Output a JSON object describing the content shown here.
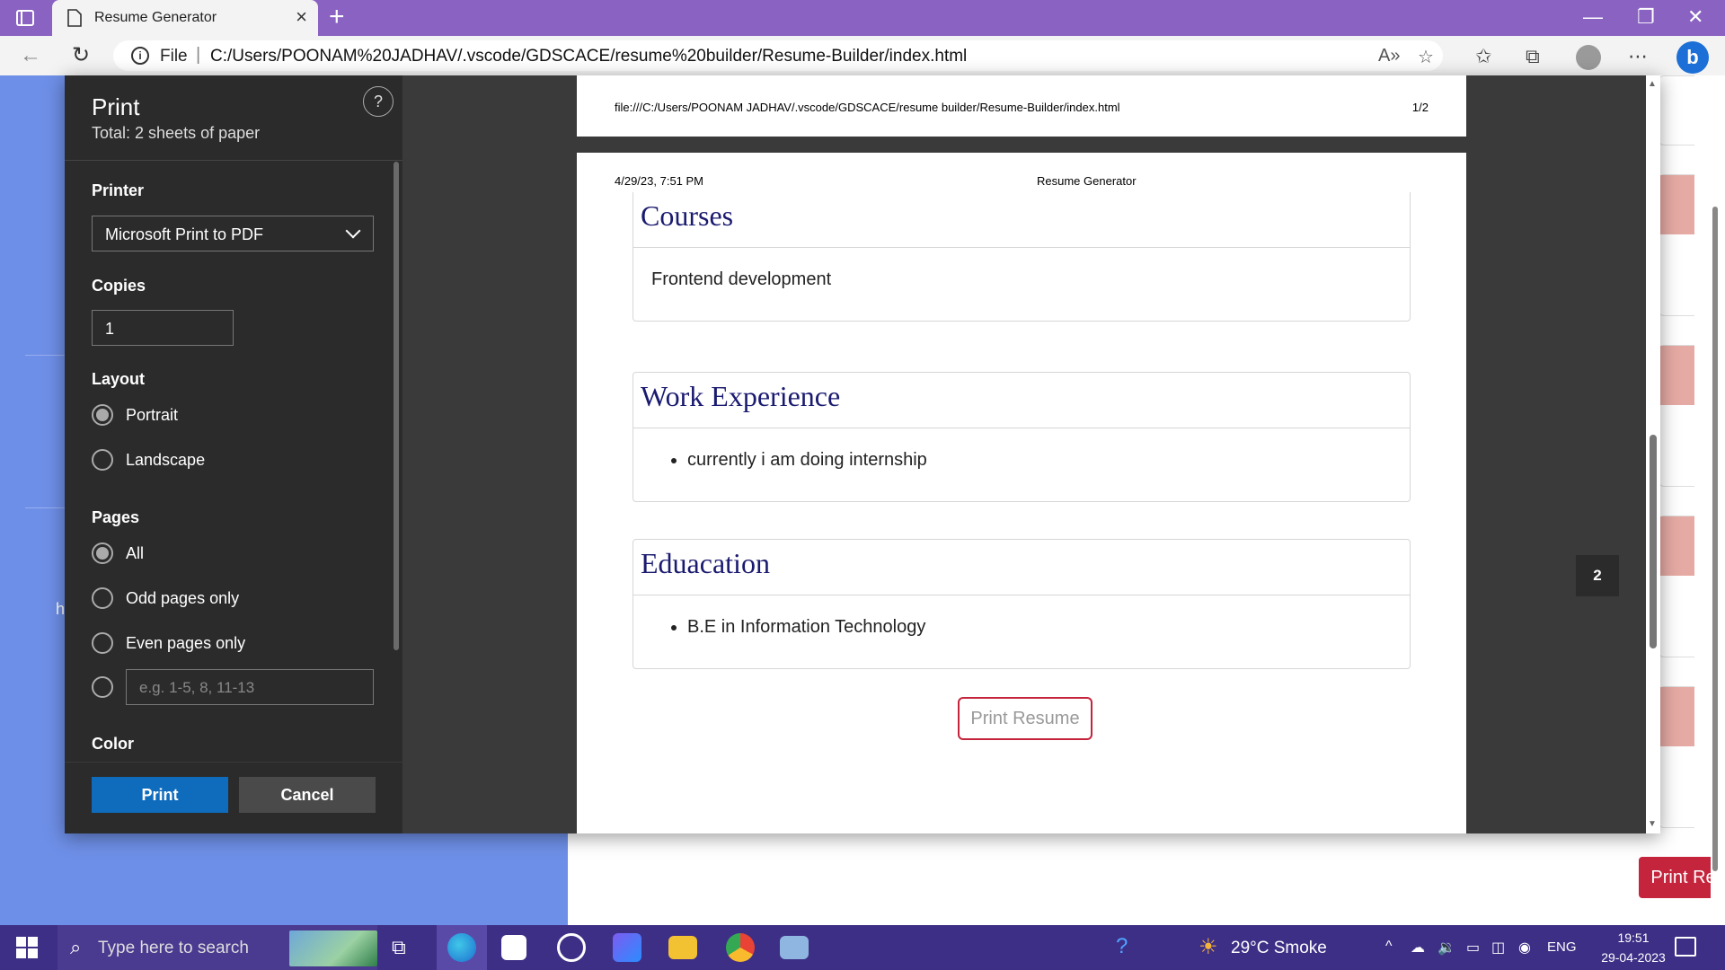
{
  "browser": {
    "tab_title": "Resume Generator",
    "address_scheme": "File",
    "url": "C:/Users/POONAM%20JADHAV/.vscode/GDSCACE/resume%20builder/Resume-Builder/index.html"
  },
  "background_page": {
    "print_button_label": "Print Resume",
    "partial_letter": "h"
  },
  "print_dialog": {
    "title": "Print",
    "subtitle": "Total: 2 sheets of paper",
    "help_symbol": "?",
    "printer_label": "Printer",
    "printer_value": "Microsoft Print to PDF",
    "copies_label": "Copies",
    "copies_value": "1",
    "layout_label": "Layout",
    "layout_options": [
      "Portrait",
      "Landscape"
    ],
    "layout_selected": "Portrait",
    "pages_label": "Pages",
    "pages_options": [
      "All",
      "Odd pages only",
      "Even pages only"
    ],
    "pages_selected": "All",
    "pages_range_placeholder": "e.g. 1-5, 8, 11-13",
    "color_label": "Color",
    "print_button": "Print",
    "cancel_button": "Cancel"
  },
  "preview": {
    "page1_footer_path": "file:///C:/Users/POONAM JADHAV/.vscode/GDSCACE/resume builder/Resume-Builder/index.html",
    "page1_footer_page": "1/2",
    "page2_header_date": "4/29/23, 7:51 PM",
    "page2_header_title": "Resume Generator",
    "sections": [
      {
        "heading": "Courses",
        "text": "Frontend development"
      },
      {
        "heading": "Work Experience",
        "bullet": "currently i am doing internship"
      },
      {
        "heading": "Eduacation",
        "bullet": "B.E in Information Technology"
      }
    ],
    "resume_button": "Print Resume",
    "page_badge": "2"
  },
  "taskbar": {
    "search_placeholder": "Type here to search",
    "weather": "29°C  Smoke",
    "language": "ENG",
    "time": "19:51",
    "date": "29-04-2023"
  }
}
